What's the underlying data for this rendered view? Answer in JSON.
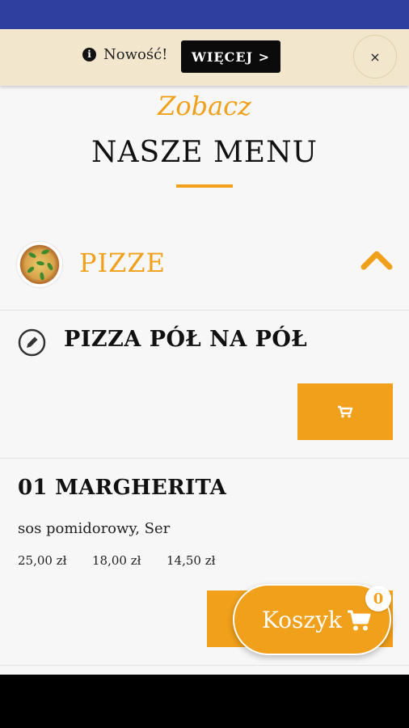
{
  "banner": {
    "info_icon": "info-icon",
    "text": "Nowość!",
    "more_label": "WIĘCEJ >",
    "close_label": "×"
  },
  "header": {
    "subtitle": "Zobacz",
    "title": "NASZE MENU"
  },
  "category": {
    "name": "PIZZE",
    "expanded": true
  },
  "items": [
    {
      "title": "PIZZA PÓŁ NA PÓŁ",
      "icon": "edit-icon"
    },
    {
      "title": "01 MARGHERITA",
      "description": "sos pomidorowy, Ser",
      "prices": [
        "25,00 zł",
        "18,00 zł",
        "14,50 zł"
      ]
    }
  ],
  "cart": {
    "label": "Koszyk",
    "count": "0"
  },
  "colors": {
    "accent": "#f0a01a",
    "status_bar": "#2f3f9f",
    "banner_bg": "#f2e6cc",
    "page_bg": "#f7f7f7"
  }
}
